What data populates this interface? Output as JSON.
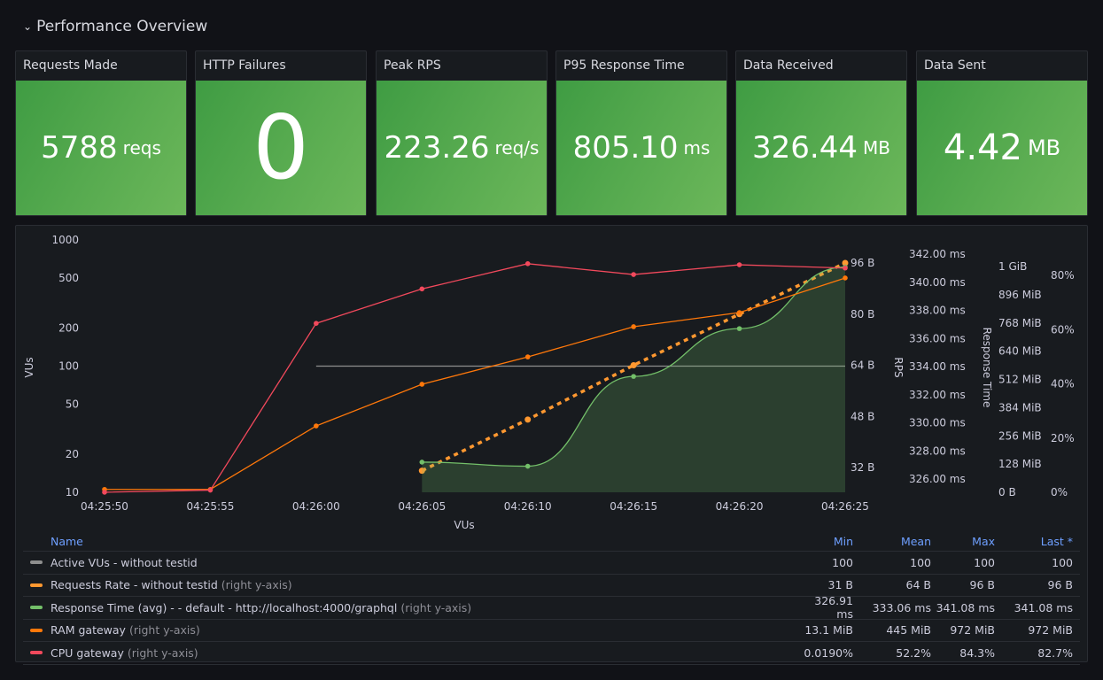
{
  "row": {
    "title": "Performance Overview",
    "icon": "chevron-down-icon"
  },
  "stats": [
    {
      "title": "Requests Made",
      "value": "5788",
      "unit": "reqs"
    },
    {
      "title": "HTTP Failures",
      "value": "0",
      "unit": ""
    },
    {
      "title": "Peak RPS",
      "value": "223.26",
      "unit": "req/s"
    },
    {
      "title": "P95 Response Time",
      "value": "805.10",
      "unit": "ms"
    },
    {
      "title": "Data Received",
      "value": "326.44",
      "unit": "MB"
    },
    {
      "title": "Data Sent",
      "value": "4.42",
      "unit": "MB"
    }
  ],
  "stat_color": "#56aa4f",
  "chart_data": {
    "type": "line",
    "xlabel": "VUs",
    "x_ticks": [
      "04:25:50",
      "04:25:55",
      "04:26:00",
      "04:26:05",
      "04:26:10",
      "04:26:15",
      "04:26:20",
      "04:26:25"
    ],
    "axes": {
      "left": {
        "label": "VUs",
        "scale": "log",
        "range": [
          10,
          1000
        ],
        "ticks": [
          "1000",
          "500",
          "200",
          "100",
          "50",
          "20",
          "10"
        ],
        "tick_values": [
          1000,
          500,
          200,
          100,
          50,
          20,
          10
        ]
      },
      "rps": {
        "label": "RPS",
        "range": [
          32,
          96
        ],
        "ticks": [
          "96 B",
          "80 B",
          "64 B",
          "48 B",
          "32 B"
        ],
        "tick_values": [
          96,
          80,
          64,
          48,
          32
        ]
      },
      "response": {
        "label": "Response Time",
        "range": [
          326,
          342
        ],
        "ticks": [
          "342.00 ms",
          "340.00 ms",
          "338.00 ms",
          "336.00 ms",
          "334.00 ms",
          "332.00 ms",
          "330.00 ms",
          "328.00 ms",
          "326.00 ms"
        ],
        "tick_values": [
          342,
          340,
          338,
          336,
          334,
          332,
          330,
          328,
          326
        ]
      },
      "ram": {
        "label": "",
        "range": [
          0,
          1024
        ],
        "ticks": [
          "1 GiB",
          "896 MiB",
          "768 MiB",
          "640 MiB",
          "512 MiB",
          "384 MiB",
          "256 MiB",
          "128 MiB",
          "0 B"
        ],
        "tick_values": [
          1024,
          896,
          768,
          640,
          512,
          384,
          256,
          128,
          0
        ]
      },
      "cpu": {
        "label": "",
        "range": [
          0,
          80
        ],
        "ticks": [
          "80%",
          "60%",
          "40%",
          "20%",
          "0%"
        ],
        "tick_values": [
          80,
          60,
          40,
          20,
          0
        ]
      }
    },
    "series": [
      {
        "name": "Active VUs - without testid",
        "axis": "left",
        "color": "#8e8e8e",
        "style": "solid",
        "points": [
          [
            "04:26:00",
            100
          ],
          [
            "04:26:25",
            100
          ]
        ]
      },
      {
        "name": "Requests Rate - without testid",
        "axis": "rps",
        "color": "#ff9830",
        "style": "dashed",
        "points": [
          [
            "04:26:05",
            31
          ],
          [
            "04:26:10",
            47
          ],
          [
            "04:26:15",
            64
          ],
          [
            "04:26:20",
            80
          ],
          [
            "04:26:25",
            96
          ]
        ]
      },
      {
        "name": "Response Time (avg) - - default - http://localhost:4000/graphql",
        "axis": "response",
        "color": "#73bf69",
        "style": "smooth-area",
        "points": [
          [
            "04:26:05",
            327.2
          ],
          [
            "04:26:10",
            326.91
          ],
          [
            "04:26:15",
            333.3
          ],
          [
            "04:26:20",
            336.7
          ],
          [
            "04:26:25",
            341.08
          ]
        ]
      },
      {
        "name": "RAM gateway",
        "axis": "ram",
        "color": "#ff780a",
        "style": "solid",
        "points": [
          [
            "04:25:50",
            13.1
          ],
          [
            "04:25:55",
            13.1
          ],
          [
            "04:26:00",
            301
          ],
          [
            "04:26:05",
            490
          ],
          [
            "04:26:10",
            614
          ],
          [
            "04:26:15",
            751
          ],
          [
            "04:26:20",
            815
          ],
          [
            "04:26:25",
            972
          ]
        ]
      },
      {
        "name": "CPU gateway",
        "axis": "cpu",
        "color": "#f2495c",
        "style": "solid",
        "points": [
          [
            "04:25:50",
            0.019
          ],
          [
            "04:25:55",
            0.8
          ],
          [
            "04:26:00",
            62.3
          ],
          [
            "04:26:05",
            75
          ],
          [
            "04:26:10",
            84.3
          ],
          [
            "04:26:15",
            80.3
          ],
          [
            "04:26:20",
            83.9
          ],
          [
            "04:26:25",
            82.7
          ]
        ]
      }
    ]
  },
  "legend": {
    "headers": {
      "name": "Name",
      "min": "Min",
      "mean": "Mean",
      "max": "Max",
      "last": "Last *"
    },
    "rows": [
      {
        "name": "Active VUs - without testid",
        "note": "",
        "color": "#8e8e8e",
        "min": "100",
        "mean": "100",
        "max": "100",
        "last": "100"
      },
      {
        "name": "Requests Rate - without testid",
        "note": "(right y-axis)",
        "color": "#ff9830",
        "min": "31 B",
        "mean": "64 B",
        "max": "96 B",
        "last": "96 B"
      },
      {
        "name": "Response Time (avg) - - default - http://localhost:4000/graphql",
        "note": "(right y-axis)",
        "color": "#73bf69",
        "min": "326.91 ms",
        "mean": "333.06 ms",
        "max": "341.08 ms",
        "last": "341.08 ms"
      },
      {
        "name": "RAM gateway",
        "note": "(right y-axis)",
        "color": "#ff780a",
        "min": "13.1 MiB",
        "mean": "445 MiB",
        "max": "972 MiB",
        "last": "972 MiB"
      },
      {
        "name": "CPU gateway",
        "note": "(right y-axis)",
        "color": "#f2495c",
        "min": "0.0190%",
        "mean": "52.2%",
        "max": "84.3%",
        "last": "82.7%"
      }
    ]
  }
}
